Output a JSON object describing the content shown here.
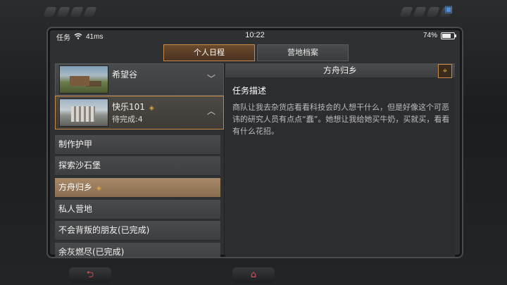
{
  "status_bar": {
    "carrier": "任务",
    "latency": "41ms",
    "time": "10:22",
    "battery": "74%",
    "battery_level": 0.74
  },
  "tabs": [
    {
      "label": "个人日程",
      "active": true
    },
    {
      "label": "营地档案",
      "active": false
    }
  ],
  "regions": [
    {
      "name": "希望谷",
      "expanded": false
    },
    {
      "name": "快乐101",
      "subtitle": "待完成:4",
      "expanded": true
    }
  ],
  "tasks": [
    {
      "label": "制作护甲"
    },
    {
      "label": "探索沙石堡"
    },
    {
      "label": "方舟归乡",
      "active": true
    },
    {
      "label": "私人营地"
    },
    {
      "label": "不会背叛的朋友(已完成)"
    },
    {
      "label": "余灰燃尽(已完成)"
    }
  ],
  "detail": {
    "header": "方舟归乡",
    "section_title": "任务描述",
    "description": "商队让我去杂货店看看科技会的人想干什么，但是好像这个可恶讳的研究人员有点点“蠢”。她想让我给她买牛奶，买就买，看看有什么花招。"
  },
  "icons": {
    "wifi": "wifi-icon",
    "battery": "battery-icon",
    "locate": "locate-target-icon",
    "back": "back-arrow-icon",
    "home": "home-icon",
    "corner": "tablet-icon"
  },
  "colors": {
    "accent": "#c88a4a",
    "active_task": "#a88a6a",
    "frame_red": "#e05050"
  }
}
